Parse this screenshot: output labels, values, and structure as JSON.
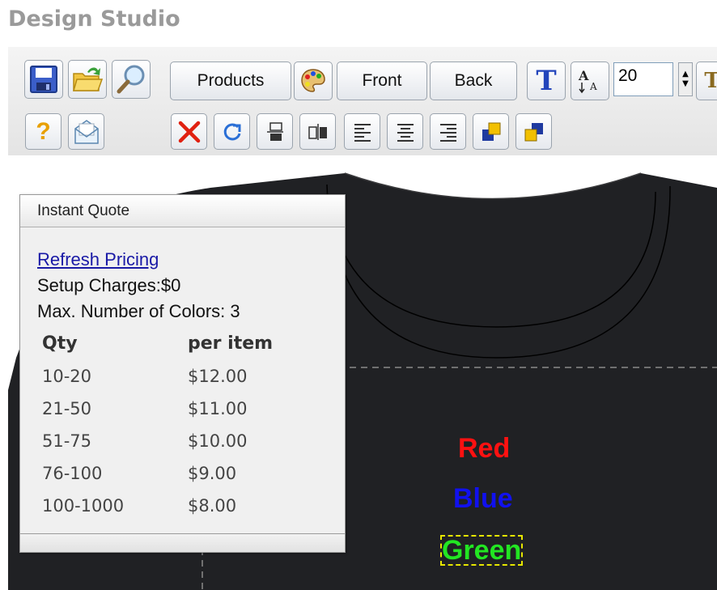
{
  "app": {
    "title": "Design Studio"
  },
  "toolbar": {
    "products_label": "Products",
    "front_label": "Front",
    "back_label": "Back",
    "font_size_value": "20",
    "spinner_up": "▲",
    "spinner_down": "▼",
    "help_glyph": "?",
    "text_glyph": "T"
  },
  "quote": {
    "title": "Instant Quote",
    "refresh_link": "Refresh Pricing",
    "setup_charges": "Setup Charges:$0",
    "max_colors": "Max. Number of Colors: 3",
    "columns": [
      "Qty",
      "per item"
    ],
    "rows": [
      {
        "qty": "10-20",
        "price": "$12.00"
      },
      {
        "qty": "21-50",
        "price": "$11.00"
      },
      {
        "qty": "51-75",
        "price": "$10.00"
      },
      {
        "qty": "76-100",
        "price": "$9.00"
      },
      {
        "qty": "100-1000",
        "price": "$8.00"
      }
    ]
  },
  "design": {
    "texts": [
      {
        "label": "Red",
        "color": "#ff1111"
      },
      {
        "label": "Blue",
        "color": "#1111ee"
      },
      {
        "label": "Green",
        "color": "#22e622"
      }
    ],
    "shirt_color": "#202124",
    "selection_outline_color": "#e6e600"
  },
  "icons": [
    "save-icon",
    "open-folder-icon",
    "zoom-icon",
    "palette-icon",
    "text-tool-icon",
    "font-size-icon",
    "help-icon",
    "mail-icon",
    "delete-icon",
    "rotate-icon",
    "flip-vertical-icon",
    "flip-horizontal-icon",
    "align-left-icon",
    "align-center-icon",
    "align-right-icon",
    "bring-forward-icon",
    "send-backward-icon"
  ]
}
